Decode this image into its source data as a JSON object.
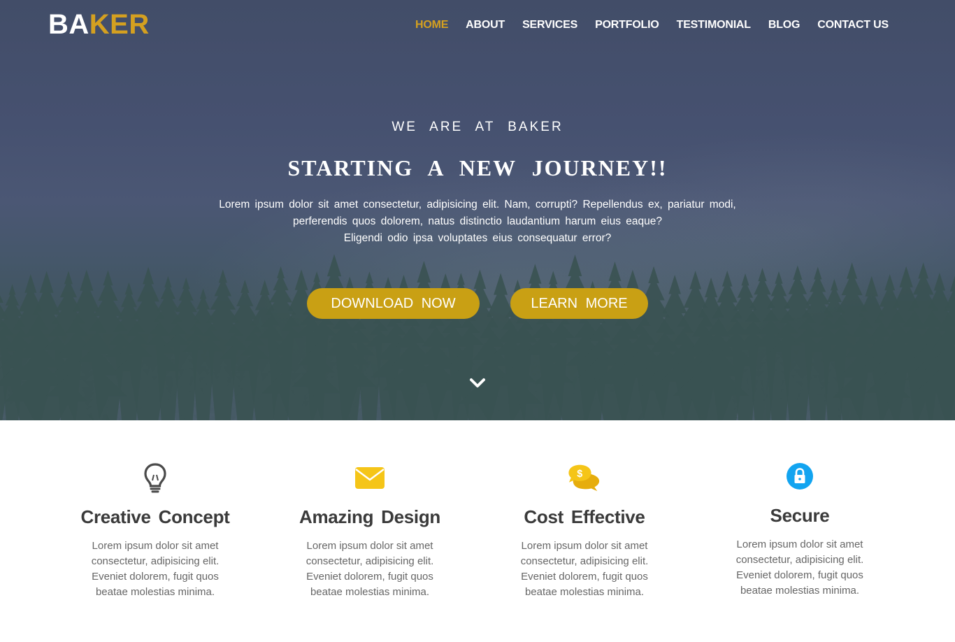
{
  "brand": {
    "part1": "BA",
    "part2": "KER",
    "accent_color": "#d4a020"
  },
  "nav": {
    "items": [
      {
        "label": "HOME",
        "active": true
      },
      {
        "label": "ABOUT"
      },
      {
        "label": "SERVICES"
      },
      {
        "label": "PORTFOLIO"
      },
      {
        "label": "TESTIMONIAL"
      },
      {
        "label": "BLOG"
      },
      {
        "label": "CONTACT US"
      }
    ]
  },
  "hero": {
    "kicker": "WE ARE AT BAKER",
    "headline": "STARTING A NEW JOURNEY!!",
    "lead_lines": [
      "Lorem ipsum dolor sit amet consectetur, adipisicing elit. Nam, corrupti? Repellendus ex, pariatur modi,",
      "perferendis quos dolorem, natus distinctio laudantium harum eius eaque?",
      "Eligendi odio ipsa voluptates eius consequatur error?"
    ],
    "buttons": {
      "download": "DOWNLOAD NOW",
      "learn": "LEARN MORE",
      "color": "#c9a014"
    },
    "scroll_icon": "chevron-down-icon"
  },
  "features": [
    {
      "icon": "lightbulb-icon",
      "title": "Creative Concept",
      "lines": [
        "Lorem ipsum dolor sit amet",
        "consectetur, adipisicing elit.",
        "Eveniet dolorem, fugit quos",
        "beatae molestias minima."
      ]
    },
    {
      "icon": "envelope-icon",
      "title": "Amazing Design",
      "lines": [
        "Lorem ipsum dolor sit amet",
        "consectetur, adipisicing elit.",
        "Eveniet dolorem, fugit quos",
        "beatae molestias minima."
      ]
    },
    {
      "icon": "dollar-chat-icon",
      "title": "Cost Effective",
      "lines": [
        "Lorem ipsum dolor sit amet",
        "consectetur, adipisicing elit.",
        "Eveniet dolorem, fugit quos",
        "beatae molestias minima."
      ]
    },
    {
      "icon": "lock-icon",
      "title": "Secure",
      "lines": [
        "Lorem ipsum dolor sit amet",
        "consectetur, adipisicing elit.",
        "Eveniet dolorem, fugit quos",
        "beatae molestias minima."
      ]
    }
  ]
}
